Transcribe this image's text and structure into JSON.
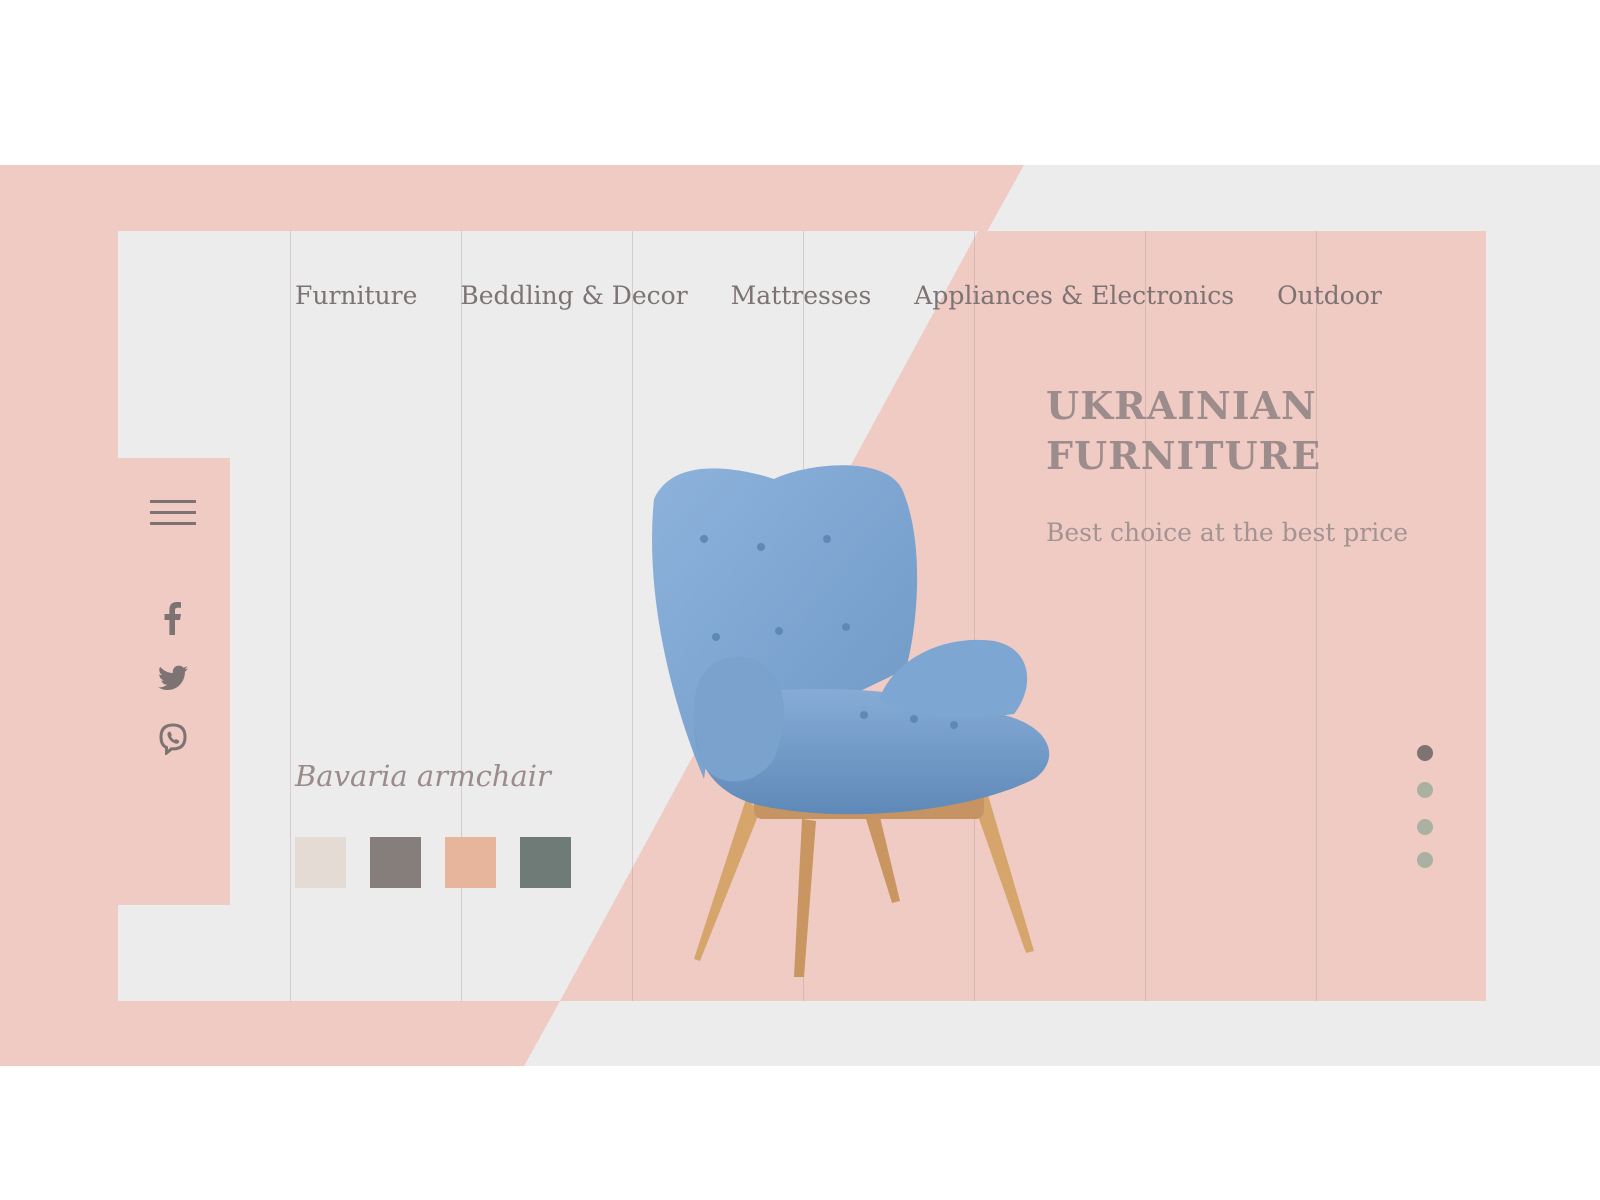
{
  "nav": {
    "items": [
      {
        "label": "Furniture"
      },
      {
        "label": "Beddling & Decor"
      },
      {
        "label": "Mattresses"
      },
      {
        "label": "Appliances & Electronics"
      },
      {
        "label": "Outdoor"
      }
    ]
  },
  "sidebar": {
    "menu_icon": "hamburger-menu-icon",
    "social": [
      {
        "icon": "facebook-icon"
      },
      {
        "icon": "twitter-icon"
      },
      {
        "icon": "viber-icon"
      }
    ]
  },
  "hero": {
    "title_line1": "UKRAINIAN",
    "title_line2": "FURNITURE",
    "subtitle": "Best choice at the best price"
  },
  "product": {
    "name": "Bavaria armchair",
    "image": "blue-armchair-image",
    "swatches": [
      {
        "color": "#e5dbd5"
      },
      {
        "color": "#867e7a"
      },
      {
        "color": "#e7b49c"
      },
      {
        "color": "#6e7b76"
      }
    ]
  },
  "pagination": {
    "dots": [
      {
        "color": "#7d7373",
        "active": true
      },
      {
        "color": "#aab1a2",
        "active": false
      },
      {
        "color": "#aab1a2",
        "active": false
      },
      {
        "color": "#aab1a2",
        "active": false
      }
    ]
  },
  "colors": {
    "pink": "#efcbc4",
    "light_gray": "#ececec",
    "text_gray": "#7d7373"
  }
}
